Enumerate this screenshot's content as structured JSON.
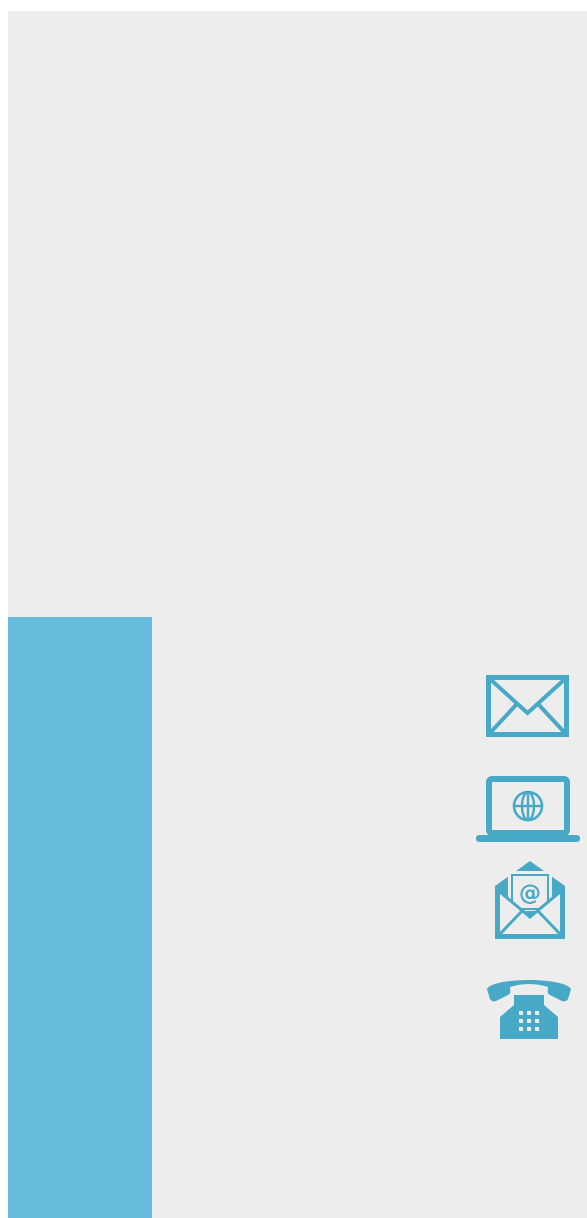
{
  "colors": {
    "page_background": "#ededed",
    "accent_bar": "#67bcdb",
    "icon_color": "#47a9c6"
  },
  "contact_icons": [
    {
      "name": "envelope-icon"
    },
    {
      "name": "laptop-globe-icon"
    },
    {
      "name": "email-at-icon"
    },
    {
      "name": "telephone-icon"
    }
  ]
}
